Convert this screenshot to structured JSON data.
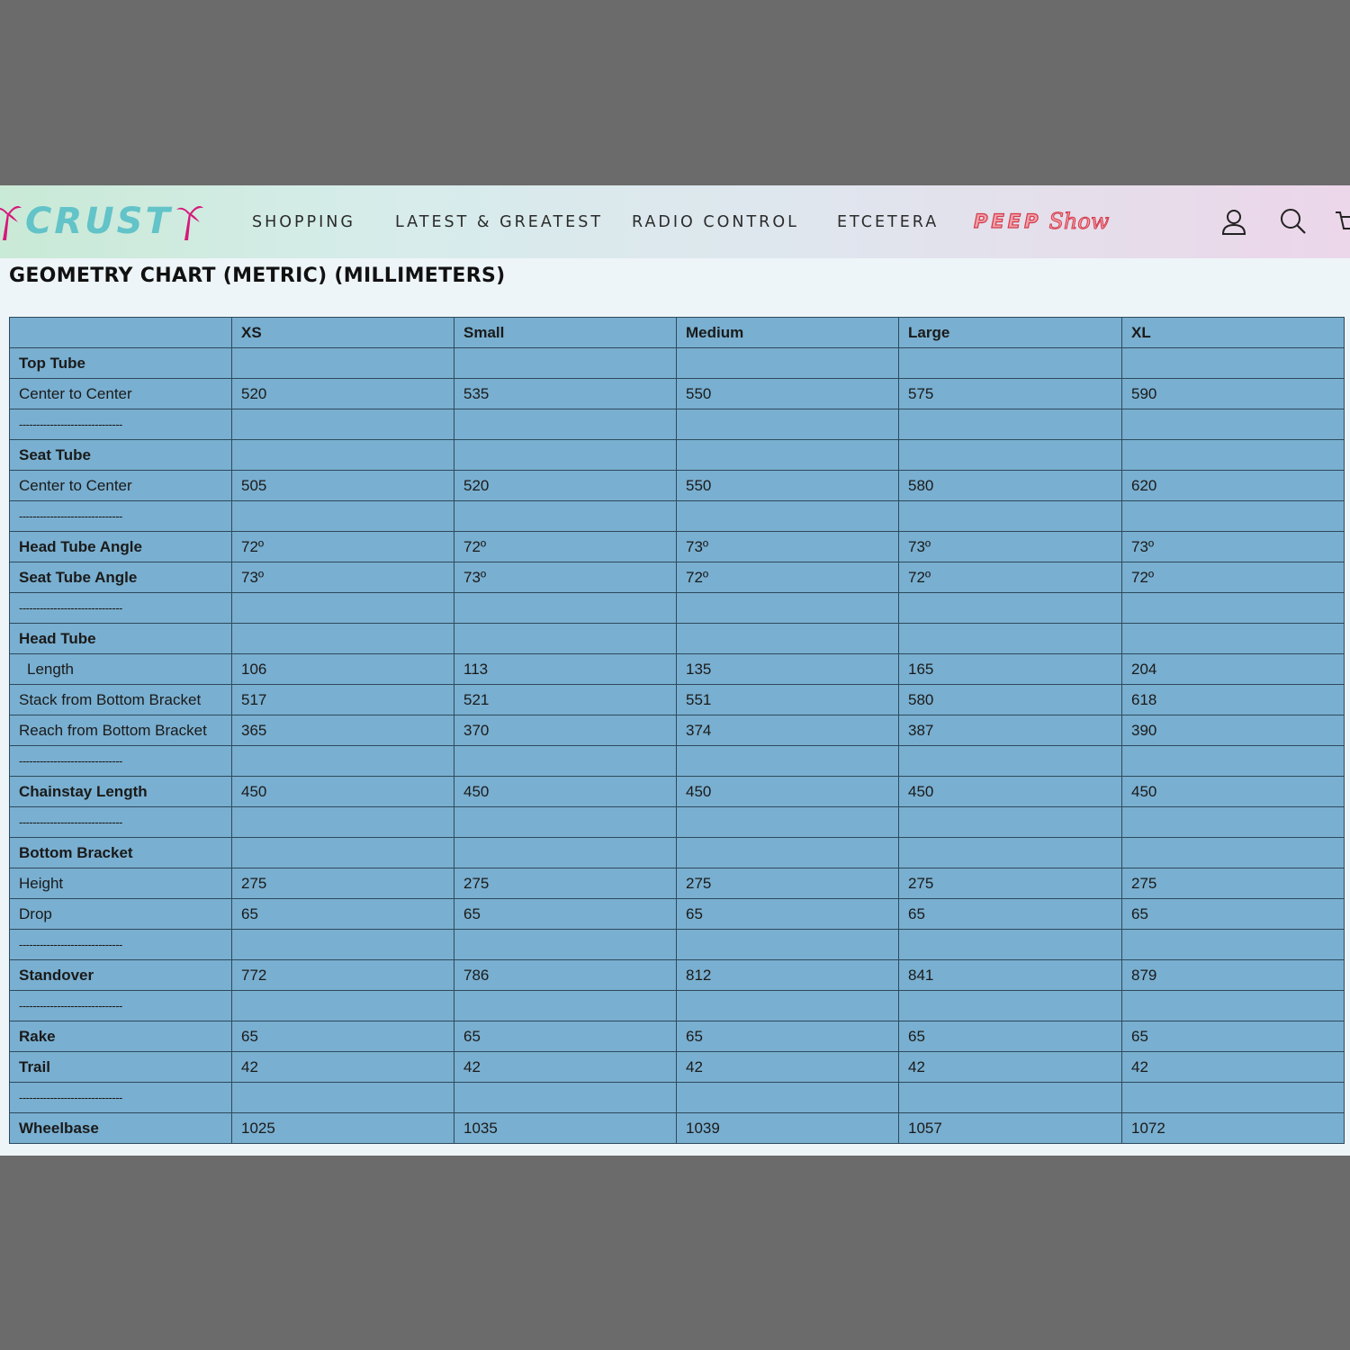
{
  "brand": {
    "logo_text": "CRUST"
  },
  "nav": {
    "items": [
      "SHOPPING",
      "LATEST & GREATEST",
      "RADIO CONTROL",
      "ETCETERA"
    ],
    "peep_show": {
      "part1": "PEEP",
      "part2": "Show"
    }
  },
  "header_icons": [
    "user-icon",
    "search-icon",
    "cart-icon"
  ],
  "page_title": "GEOMETRY CHART (METRIC) (MILLIMETERS)",
  "table": {
    "columns": [
      "",
      "XS",
      "Small",
      "Medium",
      "Large",
      "XL"
    ],
    "rows": [
      {
        "label": "Top Tube",
        "style": "bold",
        "values": [
          "",
          "",
          "",
          "",
          ""
        ]
      },
      {
        "label": "Center to Center",
        "style": "normal",
        "values": [
          "520",
          "535",
          "550",
          "575",
          "590"
        ]
      },
      {
        "label": "------------------------------",
        "style": "sep",
        "values": [
          "",
          "",
          "",
          "",
          ""
        ]
      },
      {
        "label": "Seat Tube",
        "style": "bold",
        "values": [
          "",
          "",
          "",
          "",
          ""
        ]
      },
      {
        "label": "Center to Center",
        "style": "normal",
        "values": [
          "505",
          "520",
          "550",
          "580",
          "620"
        ]
      },
      {
        "label": "------------------------------",
        "style": "sep",
        "values": [
          "",
          "",
          "",
          "",
          ""
        ]
      },
      {
        "label": "Head Tube Angle",
        "style": "bold",
        "values": [
          "72º",
          "72º",
          "73º",
          "73º",
          "73º"
        ]
      },
      {
        "label": "Seat Tube Angle",
        "style": "bold",
        "values": [
          "73º",
          "73º",
          "72º",
          "72º",
          "72º"
        ]
      },
      {
        "label": "------------------------------",
        "style": "sep",
        "values": [
          "",
          "",
          "",
          "",
          ""
        ]
      },
      {
        "label": "Head Tube",
        "style": "bold",
        "values": [
          "",
          "",
          "",
          "",
          ""
        ]
      },
      {
        "label": "Length",
        "style": "indent",
        "values": [
          "106",
          "113",
          "135",
          "165",
          "204"
        ]
      },
      {
        "label": "Stack from Bottom Bracket",
        "style": "normal",
        "values": [
          "517",
          "521",
          "551",
          "580",
          "618"
        ]
      },
      {
        "label": "Reach from Bottom Bracket",
        "style": "normal",
        "values": [
          "365",
          "370",
          "374",
          "387",
          "390"
        ]
      },
      {
        "label": "------------------------------",
        "style": "sep",
        "values": [
          "",
          "",
          "",
          "",
          ""
        ]
      },
      {
        "label": "Chainstay Length",
        "style": "bold",
        "values": [
          "450",
          "450",
          "450",
          "450",
          "450"
        ]
      },
      {
        "label": "------------------------------",
        "style": "sep",
        "values": [
          "",
          "",
          "",
          "",
          ""
        ]
      },
      {
        "label": "Bottom Bracket",
        "style": "bold",
        "values": [
          "",
          "",
          "",
          "",
          ""
        ]
      },
      {
        "label": "Height",
        "style": "normal",
        "values": [
          "275",
          "275",
          "275",
          "275",
          "275"
        ]
      },
      {
        "label": "Drop",
        "style": "normal",
        "values": [
          "65",
          "65",
          "65",
          "65",
          "65"
        ]
      },
      {
        "label": "------------------------------",
        "style": "sep",
        "values": [
          "",
          "",
          "",
          "",
          ""
        ]
      },
      {
        "label": "Standover",
        "style": "bold",
        "values": [
          "772",
          "786",
          "812",
          "841",
          "879"
        ]
      },
      {
        "label": "------------------------------",
        "style": "sep",
        "values": [
          "",
          "",
          "",
          "",
          ""
        ]
      },
      {
        "label": "Rake",
        "style": "bold",
        "values": [
          "65",
          "65",
          "65",
          "65",
          "65"
        ]
      },
      {
        "label": "Trail",
        "style": "bold",
        "values": [
          "42",
          "42",
          "42",
          "42",
          "42"
        ]
      },
      {
        "label": "------------------------------",
        "style": "sep",
        "values": [
          "",
          "",
          "",
          "",
          ""
        ]
      },
      {
        "label": "Wheelbase",
        "style": "bold",
        "values": [
          "1025",
          "1035",
          "1039",
          "1057",
          "1072"
        ]
      }
    ]
  },
  "colors": {
    "table_bg": "#79afd0",
    "table_border": "#2d4a5c",
    "logo_teal": "#62c3c8",
    "palm_magenta": "#d6187a",
    "peep_red": "#d23a4c",
    "backdrop": "#6b6b6b"
  }
}
